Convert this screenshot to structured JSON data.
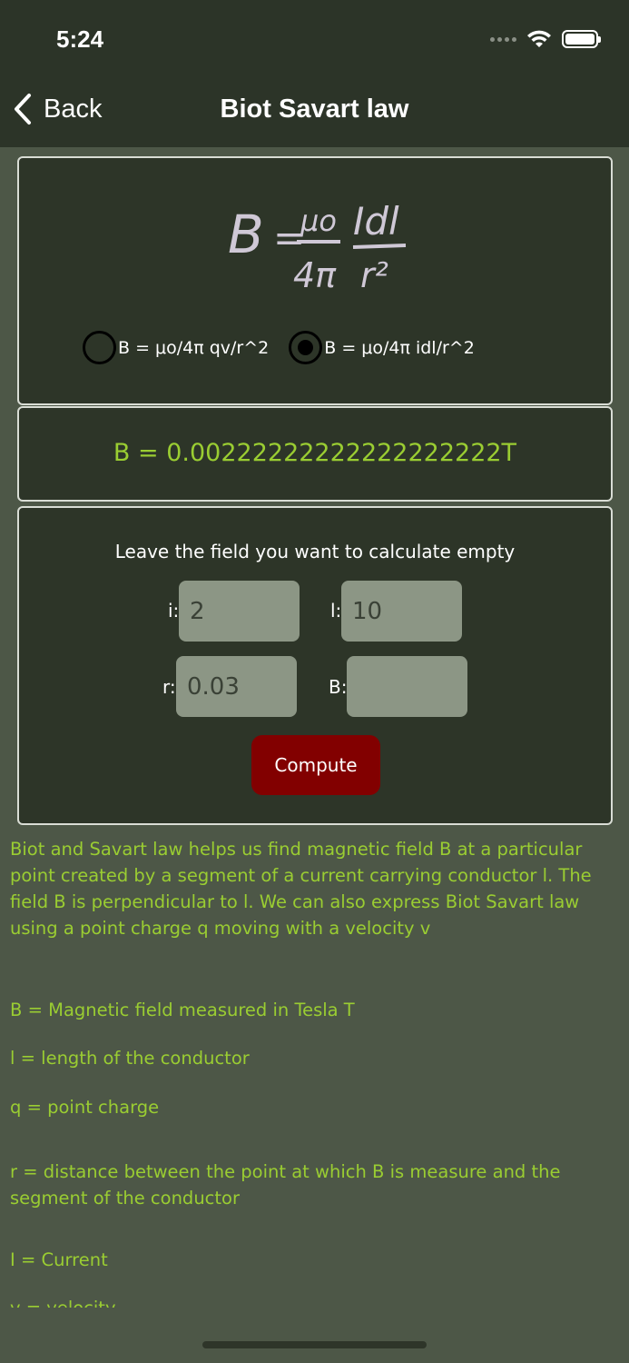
{
  "status_bar": {
    "time": "5:24"
  },
  "nav": {
    "back_label": "Back",
    "title": "Biot Savart law"
  },
  "formula": {
    "image_alt": "B = μo/4π Idl/r²",
    "glyph_B": "B",
    "glyph_eq": "=",
    "glyph_mu": "μo",
    "glyph_idl": "Idl",
    "glyph_4pi": "4π",
    "glyph_r2": "r²"
  },
  "radio": {
    "options": [
      {
        "label": "B = μo/4π qv/r^2",
        "selected": false
      },
      {
        "label": "B = μo/4π idl/r^2",
        "selected": true
      }
    ]
  },
  "result": {
    "text": "B = 0.00222222222222222222T"
  },
  "inputs": {
    "hint": "Leave the field you want to calculate empty",
    "i": {
      "label": "i:",
      "value": "2"
    },
    "l": {
      "label": "l:",
      "value": "10"
    },
    "r": {
      "label": "r:",
      "value": "0.03"
    },
    "B": {
      "label": "B:",
      "value": ""
    },
    "compute_label": "Compute"
  },
  "description": {
    "intro": "Biot and Savart law helps us find magnetic field B at a particular point created by a segment of a current carrying conductor l.   The field B is perpendicular to l.     We can also express Biot Savart law using  a point charge q moving with a velocity v",
    "def_B": "B = Magnetic field measured in Tesla T",
    "def_l": "l = length of the conductor",
    "def_q": "q = point charge",
    "def_r": "r = distance between the point at which B is measure and the segment of the conductor",
    "def_I": "I = Current",
    "def_v": "v = velocity"
  },
  "colors": {
    "background": "#4d5747",
    "nav_background": "#2c3428",
    "panel_background": "#2d3528",
    "accent_green": "#9acd32",
    "compute_button": "#820000",
    "field_background": "#8c9685"
  }
}
